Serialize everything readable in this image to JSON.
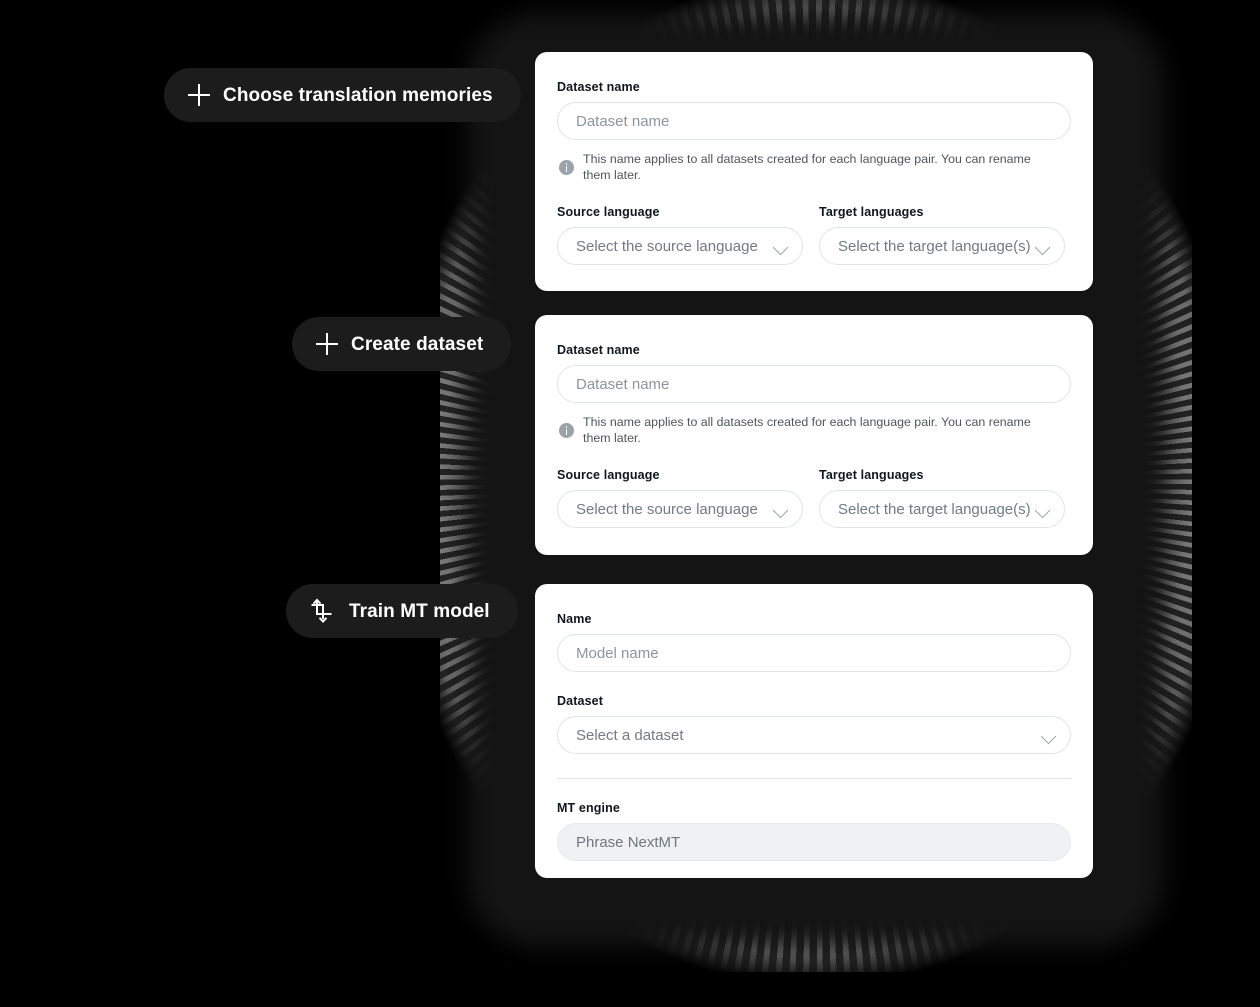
{
  "theme": {
    "background": "#000000",
    "panel": "#141414",
    "pill_bg": "#1c1c1c",
    "pill_text": "#ffffff",
    "card_bg": "#ffffff",
    "label_color": "#0f161c",
    "placeholder_color": "#8b959e",
    "hint_color": "#4d565e",
    "border_color": "#dfe4e9",
    "divider_color": "#dde5ec",
    "disabled_bg": "#eff1f3"
  },
  "steps": [
    {
      "id": "translation-memories",
      "pill": {
        "label": "Choose translation memories",
        "icon": "plus-icon"
      },
      "card": {
        "name_label": "Dataset name",
        "name_placeholder": "Dataset name",
        "name_value": "",
        "hint_icon": "info-icon",
        "hint": "This name applies to all datasets created for each language pair. You can rename them later.",
        "source_label": "Source language",
        "source_placeholder": "Select the source language",
        "target_label": "Target languages",
        "target_placeholder": "Select the target language(s)",
        "chevron_icon": "chevron-down-icon"
      }
    },
    {
      "id": "create-dataset",
      "pill": {
        "label": "Create dataset",
        "icon": "plus-icon"
      },
      "card": {
        "name_label": "Dataset name",
        "name_placeholder": "Dataset name",
        "name_value": "",
        "hint_icon": "info-icon",
        "hint": "This name applies to all datasets created for each language pair. You can rename them later.",
        "source_label": "Source language",
        "source_placeholder": "Select the source language",
        "target_label": "Target languages",
        "target_placeholder": "Select the target language(s)",
        "chevron_icon": "chevron-down-icon"
      }
    },
    {
      "id": "train-mt-model",
      "pill": {
        "label": "Train MT model",
        "icon": "crop-transform-icon"
      },
      "card": {
        "name_label": "Name",
        "name_placeholder": "Model name",
        "name_value": "",
        "dataset_label": "Dataset",
        "dataset_placeholder": "Select a dataset",
        "chevron_icon": "chevron-down-icon",
        "engine_label": "MT engine",
        "engine_value": "Phrase NextMT",
        "engine_disabled": true
      }
    }
  ]
}
